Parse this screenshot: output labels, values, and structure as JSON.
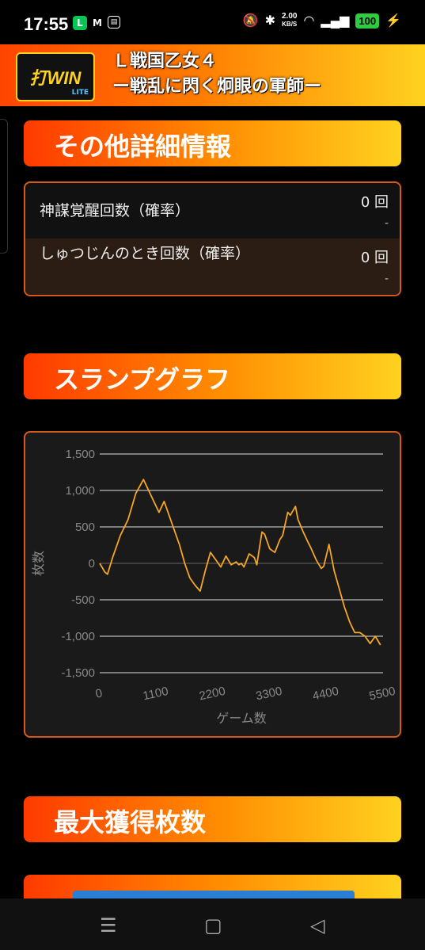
{
  "status_bar": {
    "time": "17:55",
    "net_speed_value": "2.00",
    "net_speed_unit": "KB/S",
    "battery": "100"
  },
  "app": {
    "logo_text": "打WIN",
    "logo_sub": "LITE",
    "title_line1": "Ｌ戦国乙女４",
    "title_line2": "ー戦乱に閃く炯眼の軍師ー"
  },
  "sections": {
    "other_details": "その他詳細情報",
    "slump_graph": "スランプグラフ",
    "max_win": "最大獲得枚数"
  },
  "details": [
    {
      "label": "神謀覚醒回数（確率）",
      "value": "0 回",
      "rate": "-"
    },
    {
      "label": "しゅつじんのとき回数（確率）",
      "value": "0 回",
      "rate": "-"
    }
  ],
  "nav": {
    "recent": "☰",
    "home": "▢",
    "back": "◁"
  },
  "chart_data": {
    "type": "line",
    "xlabel": "ゲーム数",
    "ylabel": "枚数",
    "xlim": [
      0,
      5500
    ],
    "ylim": [
      -1500,
      1500
    ],
    "x_ticks": [
      "0",
      "1100",
      "2200",
      "3300",
      "4400",
      "5500"
    ],
    "y_ticks": [
      "1,500",
      "1,000",
      "500",
      "0",
      "-500",
      "-1,000",
      "-1,500"
    ],
    "line_color": "#f5a623",
    "grid": true,
    "series": [
      {
        "x": [
          0,
          100,
          150,
          250,
          400,
          550,
          700,
          850,
          950,
          1050,
          1150,
          1250,
          1350,
          1450,
          1550,
          1650,
          1750,
          1850,
          1950,
          2050,
          2150,
          2250,
          2350,
          2450,
          2550,
          2650,
          2700,
          2750,
          2800,
          2900,
          3000,
          3050,
          3150,
          3200,
          3300,
          3400,
          3500,
          3550,
          3650,
          3700,
          3800,
          3850,
          3950,
          4050,
          4100,
          4200,
          4300,
          4350,
          4450,
          4550,
          4650,
          4750,
          4850,
          4950,
          5050,
          5150,
          5250,
          5350,
          5450
        ],
        "y": [
          0,
          -120,
          -150,
          80,
          380,
          600,
          960,
          1150,
          1000,
          850,
          700,
          850,
          650,
          450,
          250,
          0,
          -200,
          -300,
          -380,
          -100,
          150,
          50,
          -50,
          100,
          -20,
          20,
          -20,
          0,
          -50,
          130,
          80,
          -20,
          430,
          400,
          200,
          150,
          330,
          380,
          700,
          660,
          780,
          600,
          430,
          280,
          210,
          50,
          -70,
          -40,
          260,
          -100,
          -350,
          -600,
          -800,
          -950,
          -950,
          -1000,
          -1100,
          -1000,
          -1120
        ]
      }
    ]
  }
}
